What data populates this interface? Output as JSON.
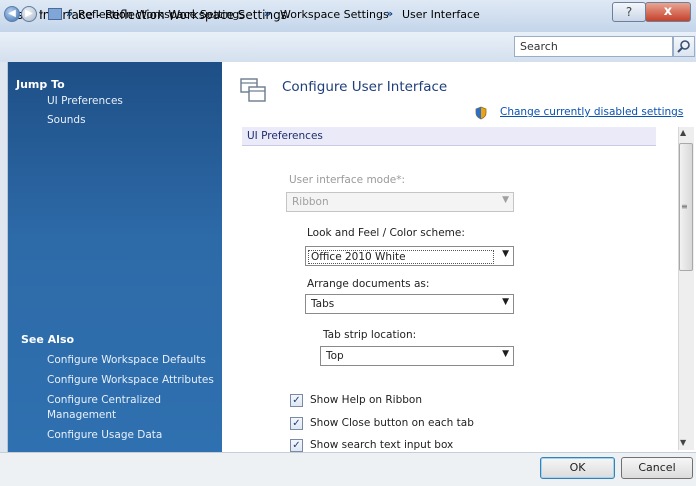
{
  "window": {
    "title": "User Interface - Reflection Workspace Settings",
    "help_glyph": "?",
    "close_glyph": "x"
  },
  "navbar": {
    "back_glyph": "◀",
    "forward_glyph": "▶",
    "dropdown_glyph": "▾",
    "sep": "»",
    "breadcrumbs": [
      "Reflection Workspace Settings",
      "Workspace Settings",
      "User Interface"
    ],
    "search_placeholder": "Search"
  },
  "sidebar": {
    "jump_to": {
      "heading": "Jump To",
      "items": [
        "UI Preferences",
        "Sounds"
      ]
    },
    "see_also": {
      "heading": "See Also",
      "items": [
        "Configure Workspace Defaults",
        "Configure Workspace Attributes",
        "Configure Centralized Management",
        "Configure Usage Data"
      ]
    }
  },
  "main": {
    "title": "Configure User Interface",
    "change_link": "Change currently disabled settings",
    "section": "UI Preferences",
    "ui_mode": {
      "label": "User interface mode*:",
      "value": "Ribbon",
      "disabled": true
    },
    "look_feel": {
      "label": "Look and Feel / Color scheme:",
      "value": "Office 2010 White"
    },
    "arrange": {
      "label": "Arrange documents as:",
      "value": "Tabs"
    },
    "tab_strip": {
      "label": "Tab strip location:",
      "value": "Top"
    },
    "checkboxes": [
      {
        "label": "Show Help on Ribbon",
        "checked": true
      },
      {
        "label": "Show Close button on each tab",
        "checked": true
      },
      {
        "label": "Show search text input box",
        "checked": true
      }
    ],
    "check_glyph": "✓"
  },
  "footer": {
    "ok": "OK",
    "cancel": "Cancel"
  },
  "colors": {
    "sidebar_top": "#1e4f86",
    "sidebar_bottom": "#2f70b0",
    "link": "#0b52b0",
    "title": "#1f3f7a"
  }
}
